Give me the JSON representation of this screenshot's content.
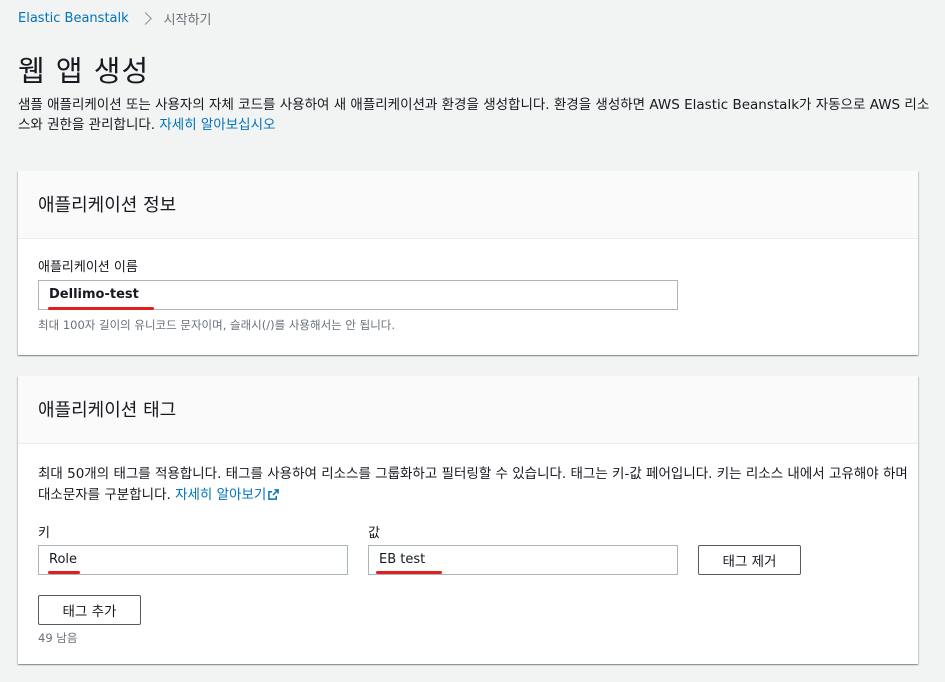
{
  "breadcrumb": {
    "root": "Elastic Beanstalk",
    "current": "시작하기"
  },
  "page": {
    "title": "웹 앱 생성",
    "description": "샘플 애플리케이션 또는 사용자의 자체 코드를 사용하여 새 애플리케이션과 환경을 생성합니다. 환경을 생성하면 AWS Elastic Beanstalk가 자동으로 AWS 리소스와 권한을 관리합니다.",
    "learn_more": "자세히 알아보십시오"
  },
  "app_info": {
    "header": "애플리케이션 정보",
    "name_label": "애플리케이션 이름",
    "name_value": "Dellimo-test",
    "name_hint": "최대 100자 길이의 유니코드 문자이며, 슬래시(/)를 사용해서는 안 됩니다."
  },
  "app_tags": {
    "header": "애플리케이션 태그",
    "description": "최대 50개의 태그를 적용합니다. 태그를 사용하여 리소스를 그룹화하고 필터링할 수 있습니다. 태그는 키-값 페어입니다. 키는 리소스 내에서 고유해야 하며 대소문자를 구분합니다.",
    "learn_more": "자세히 알아보기",
    "key_label": "키",
    "value_label": "값",
    "key_value": "Role",
    "value_value": "EB test",
    "remove_button": "태그 제거",
    "add_button": "태그 추가",
    "remaining": "49 남음"
  },
  "colors": {
    "link": "#0073bb",
    "annotation_underline": "#e02020",
    "page_background": "#f2f3f3"
  },
  "icons": {
    "breadcrumb_separator": "chevron-right-icon",
    "external_link": "external-link-icon"
  }
}
